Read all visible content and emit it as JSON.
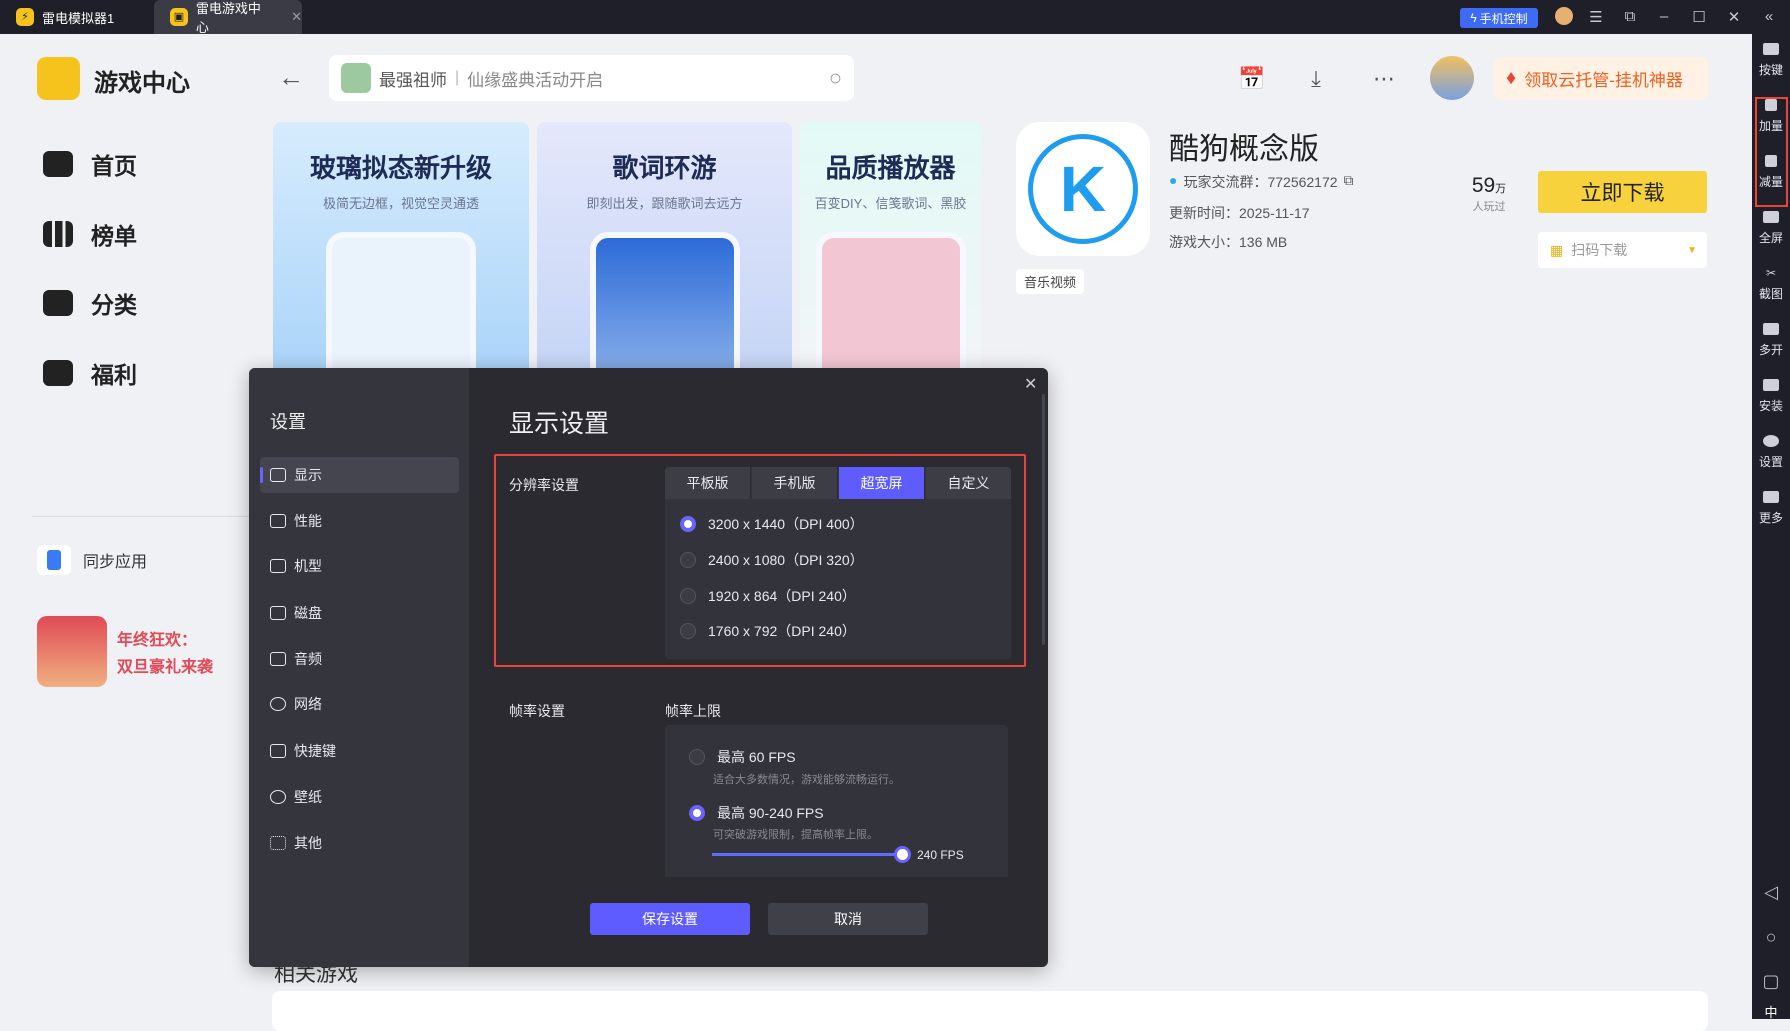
{
  "titlebar": {
    "tabs": [
      {
        "label": "雷电模拟器1"
      },
      {
        "label": "雷电游戏中心"
      }
    ],
    "phone_control": "手机控制"
  },
  "sidebar": {
    "app_title": "游戏中心",
    "items": [
      {
        "label": "首页"
      },
      {
        "label": "榜单"
      },
      {
        "label": "分类"
      },
      {
        "label": "福利"
      }
    ],
    "sync": "同步应用",
    "promo_line1": "年终狂欢：",
    "promo_line2": "双旦豪礼来袭"
  },
  "header": {
    "search_game": "最强祖师",
    "search_hint": "仙缘盛典活动开启",
    "cloud_button": "领取云托管-挂机神器"
  },
  "banners": [
    {
      "title": "玻璃拟态新升级",
      "subtitle": "极简无边框，视觉空灵通透"
    },
    {
      "title": "歌词环游",
      "subtitle": "即刻出发，跟随歌词去远方"
    },
    {
      "title": "品质播放器",
      "subtitle": "百变DIY、信笺歌词、黑胶"
    }
  ],
  "app": {
    "name": "酷狗概念版",
    "group": "玩家交流群：772562172",
    "updated": "更新时间：2025-11-17",
    "size": "游戏大小：136 MB",
    "tag": "音乐视频",
    "players": "59",
    "players_unit": "万",
    "players_label": "人玩过",
    "download": "立即下载",
    "qr_download": "扫码下载",
    "related": "相关游戏"
  },
  "rightbar": [
    {
      "label": "按键"
    },
    {
      "label": "加量"
    },
    {
      "label": "减量"
    },
    {
      "label": "全屏"
    },
    {
      "label": "截图"
    },
    {
      "label": "多开"
    },
    {
      "label": "安装"
    },
    {
      "label": "设置"
    },
    {
      "label": "更多"
    }
  ],
  "ime": "中",
  "settings": {
    "title": "设置",
    "menu": [
      {
        "label": "显示"
      },
      {
        "label": "性能"
      },
      {
        "label": "机型"
      },
      {
        "label": "磁盘"
      },
      {
        "label": "音频"
      },
      {
        "label": "网络"
      },
      {
        "label": "快捷键"
      },
      {
        "label": "壁纸"
      },
      {
        "label": "其他"
      }
    ],
    "heading": "显示设置",
    "resolution_label": "分辨率设置",
    "res_tabs": [
      {
        "label": "平板版"
      },
      {
        "label": "手机版"
      },
      {
        "label": "超宽屏"
      },
      {
        "label": "自定义"
      }
    ],
    "resolutions": [
      {
        "label": "3200 x 1440（DPI 400）"
      },
      {
        "label": "2400 x 1080（DPI 320）"
      },
      {
        "label": "1920 x 864（DPI 240）"
      },
      {
        "label": "1760 x 792（DPI 240）"
      }
    ],
    "fps_label": "帧率设置",
    "fps_cap_label": "帧率上限",
    "fps_options": [
      {
        "label": "最高 60 FPS",
        "desc": "适合大多数情况，游戏能够流畅运行。"
      },
      {
        "label": "最高 90-240 FPS",
        "desc": "可突破游戏限制，提高帧率上限。"
      }
    ],
    "fps_value": "240 FPS",
    "fps_slider_fraction": 1.0,
    "save": "保存设置",
    "cancel": "取消"
  },
  "colors": {
    "accent": "#5f5cff",
    "yellow": "#f8d23c",
    "highlight": "#e8463a"
  }
}
